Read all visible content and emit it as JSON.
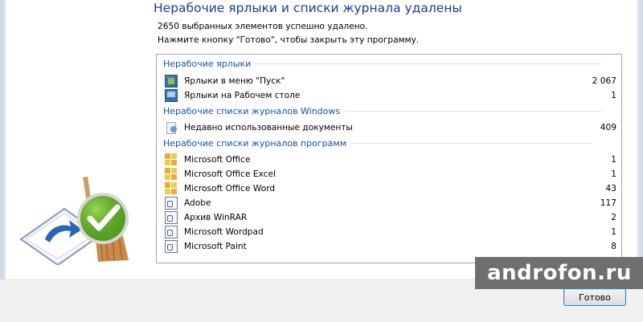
{
  "header": {
    "title": "Нерабочие ярлыки и списки журнала удалены",
    "info_line_1": "2650 выбранных элементов успешно удалено.",
    "info_line_2": "Нажмите кнопку \"Готово\", чтобы закрыть эту программу."
  },
  "groups": [
    {
      "title": "Нерабочие ярлыки",
      "items": [
        {
          "label": "Ярлыки в меню \"Пуск\"",
          "count": "2 067",
          "icon": "start-menu-icon"
        },
        {
          "label": "Ярлыки на Рабочем столе",
          "count": "1",
          "icon": "desktop-icon"
        }
      ]
    },
    {
      "title": "Нерабочие списки журналов Windows",
      "items": [
        {
          "label": "Недавно использованные документы",
          "count": "409",
          "icon": "recent-documents-icon"
        }
      ]
    },
    {
      "title": "Нерабочие списки журналов программ",
      "items": [
        {
          "label": "Microsoft Office",
          "count": "1",
          "icon": "office-icon"
        },
        {
          "label": "Microsoft Office Excel",
          "count": "1",
          "icon": "office-icon"
        },
        {
          "label": "Microsoft Office Word",
          "count": "43",
          "icon": "office-icon"
        },
        {
          "label": "Adobe",
          "count": "117",
          "icon": "application-icon"
        },
        {
          "label": "Архив WinRAR",
          "count": "2",
          "icon": "application-icon"
        },
        {
          "label": "Microsoft Wordpad",
          "count": "1",
          "icon": "application-icon"
        },
        {
          "label": "Microsoft Paint",
          "count": "8",
          "icon": "application-icon"
        }
      ]
    }
  ],
  "footer": {
    "done_label": "Готово"
  },
  "watermark": "androfon.ru",
  "colors": {
    "heading": "#1e3a8f",
    "group_header": "#1b4e9a",
    "check_green": "#5aa623"
  }
}
